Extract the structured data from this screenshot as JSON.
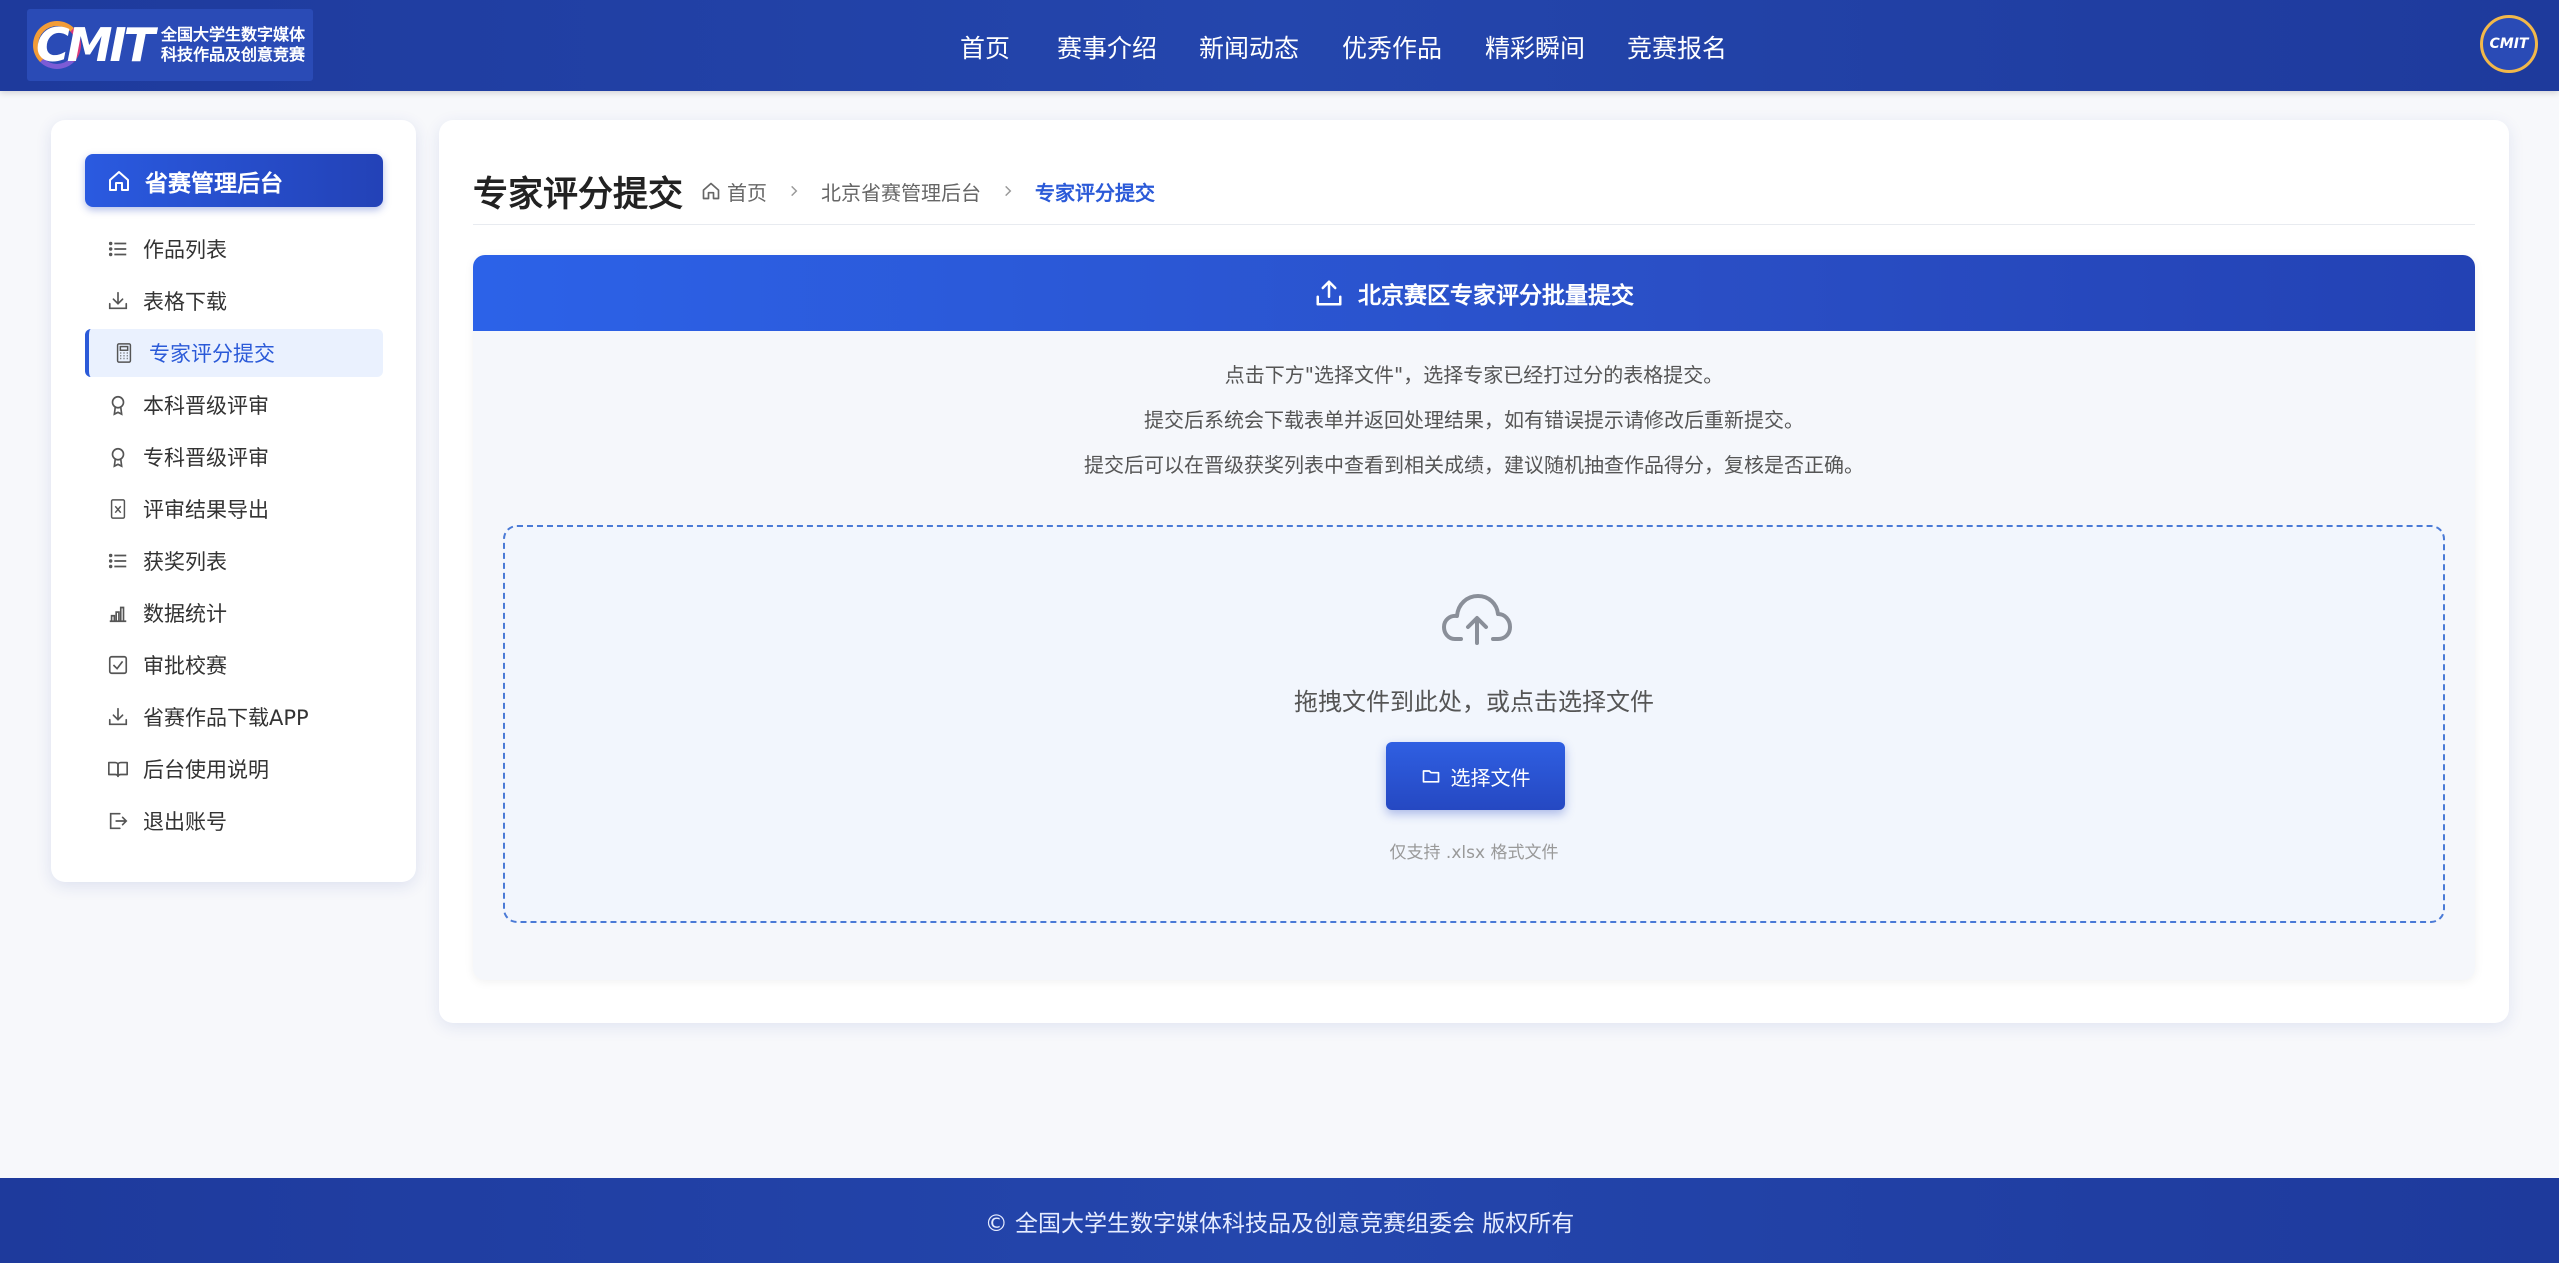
{
  "header": {
    "logo_mark": "CMIT",
    "logo_lines": [
      "全国大学生数字媒体",
      "科技作品及创意竞赛"
    ],
    "nav": [
      "首页",
      "赛事介绍",
      "新闻动态",
      "优秀作品",
      "精彩瞬间",
      "竞赛报名"
    ],
    "avatar_text": "CMIT"
  },
  "sidebar": {
    "title": "省赛管理后台",
    "items": [
      {
        "label": "作品列表",
        "icon": "list-icon"
      },
      {
        "label": "表格下载",
        "icon": "download-icon"
      },
      {
        "label": "专家评分提交",
        "icon": "calculator-icon",
        "active": true
      },
      {
        "label": "本科晋级评审",
        "icon": "award-icon"
      },
      {
        "label": "专科晋级评审",
        "icon": "award-icon"
      },
      {
        "label": "评审结果导出",
        "icon": "excel-file-icon"
      },
      {
        "label": "获奖列表",
        "icon": "list-icon"
      },
      {
        "label": "数据统计",
        "icon": "bar-chart-icon"
      },
      {
        "label": "审批校赛",
        "icon": "checkbox-icon"
      },
      {
        "label": "省赛作品下载APP",
        "icon": "download-icon"
      },
      {
        "label": "后台使用说明",
        "icon": "book-icon"
      },
      {
        "label": "退出账号",
        "icon": "logout-icon"
      }
    ]
  },
  "main": {
    "page_title": "专家评分提交",
    "breadcrumb": [
      "首页",
      "北京省赛管理后台",
      "专家评分提交"
    ],
    "card_title": "北京赛区专家评分批量提交",
    "notes": [
      "点击下方\"选择文件\"，选择专家已经打过分的表格提交。",
      "提交后系统会下载表单并返回处理结果，如有错误提示请修改后重新提交。",
      "提交后可以在晋级获奖列表中查看到相关成绩，建议随机抽查作品得分，复核是否正确。"
    ],
    "drop_text": "拖拽文件到此处，或点击选择文件",
    "choose_button": "选择文件",
    "hint": "仅支持 .xlsx 格式文件"
  },
  "footer": {
    "copyright": "© 全国大学生数字媒体科技品及创意竞赛组委会 版权所有"
  },
  "colors": {
    "primary": "#2b5ad8",
    "header_bg": "#2342b0",
    "page_bg": "#f7f8fb"
  }
}
